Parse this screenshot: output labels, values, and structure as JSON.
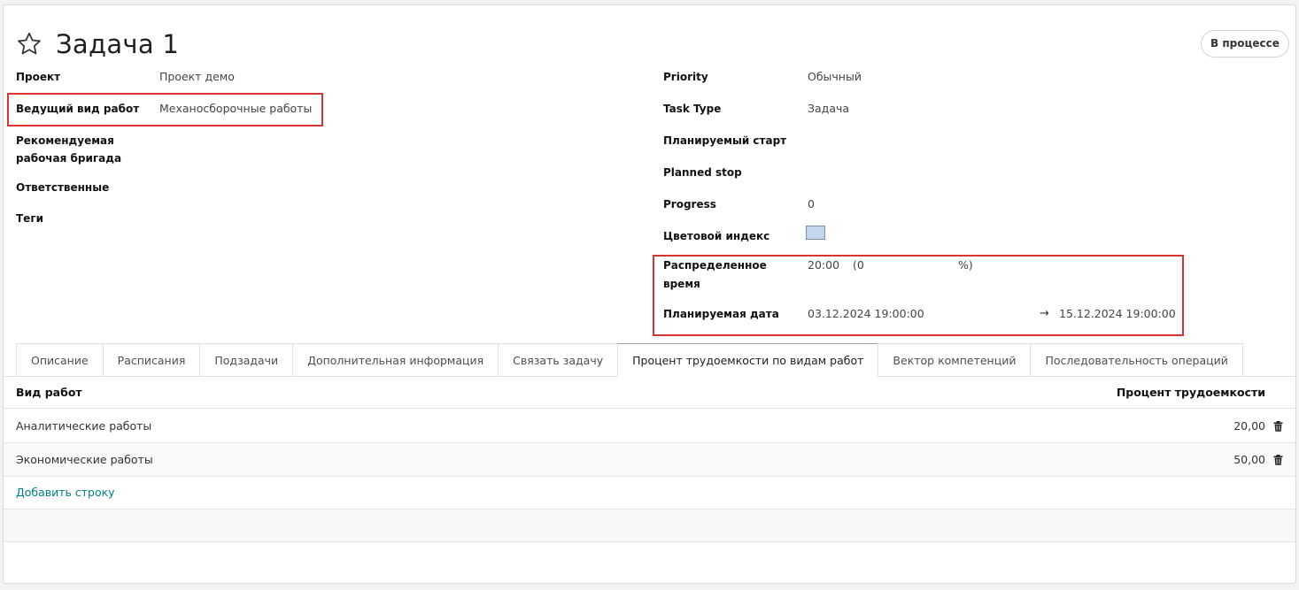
{
  "title": "Задача 1",
  "status": "В процессе",
  "left_fields": {
    "project_label": "Проект",
    "project_value": "Проект демо",
    "lead_work_label": "Ведущий вид работ",
    "lead_work_value": "Механосборочные работы",
    "crew_label_line1": "Рекомендуемая",
    "crew_label_line2": "рабочая бригада",
    "responsible_label": "Ответственные",
    "tags_label": "Теги"
  },
  "right_fields": {
    "priority_label": "Priority",
    "priority_value": "Обычный",
    "task_type_label": "Task Type",
    "task_type_value": "Задача",
    "planned_start_label": "Планируемый старт",
    "planned_stop_label": "Planned stop",
    "progress_label": "Progress",
    "progress_value": "0",
    "color_label": "Цветовой индекс",
    "color_value": "#c3d6ee",
    "allocated_label_line1": "Распределенное",
    "allocated_label_line2": "время",
    "allocated_time": "20:00",
    "allocated_pct_open": "(0",
    "allocated_pct_close": "%)",
    "planned_date_label": "Планируемая дата",
    "planned_date_start": "03.12.2024 19:00:00",
    "planned_date_arrow": "→",
    "planned_date_end": "15.12.2024 19:00:00"
  },
  "tabs": [
    {
      "label": "Описание"
    },
    {
      "label": "Расписания"
    },
    {
      "label": "Подзадачи"
    },
    {
      "label": "Дополнительная информация"
    },
    {
      "label": "Связать задачу"
    },
    {
      "label": "Процент трудоемкости по видам работ",
      "active": true
    },
    {
      "label": "Вектор компетенций"
    },
    {
      "label": "Последовательность операций"
    }
  ],
  "table": {
    "col_work_type": "Вид работ",
    "col_percent": "Процент трудоемкости",
    "rows": [
      {
        "work_type": "Аналитические работы",
        "percent": "20,00"
      },
      {
        "work_type": "Экономические работы",
        "percent": "50,00"
      }
    ],
    "add_row": "Добавить строку"
  },
  "icons": {
    "favorite": "star-outline-icon",
    "delete": "trash-icon"
  },
  "colors": {
    "highlight": "#d9352f",
    "link": "#017e84"
  }
}
